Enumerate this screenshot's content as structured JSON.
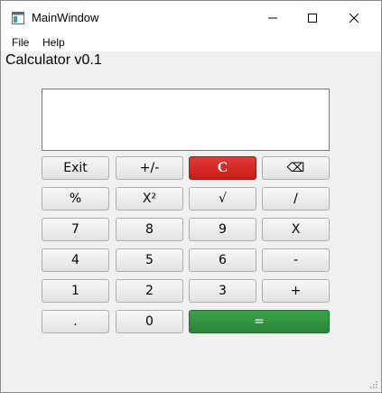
{
  "window": {
    "title": "MainWindow"
  },
  "menu": {
    "file": "File",
    "help": "Help"
  },
  "app": {
    "heading": "Calculator v0.1"
  },
  "display": {
    "value": ""
  },
  "buttons": {
    "exit": "Exit",
    "plus_minus": "+/-",
    "clear": "C",
    "backspace": "⌫",
    "percent": "%",
    "square": "X²",
    "sqrt": "√",
    "divide": "/",
    "seven": "7",
    "eight": "8",
    "nine": "9",
    "multiply": "X",
    "four": "4",
    "five": "5",
    "six": "6",
    "minus": "-",
    "one": "1",
    "two": "2",
    "three": "3",
    "plus": "+",
    "dot": ".",
    "zero": "0",
    "equals": "="
  },
  "colors": {
    "clear_button": "#d42a26",
    "equals_button": "#339944"
  }
}
